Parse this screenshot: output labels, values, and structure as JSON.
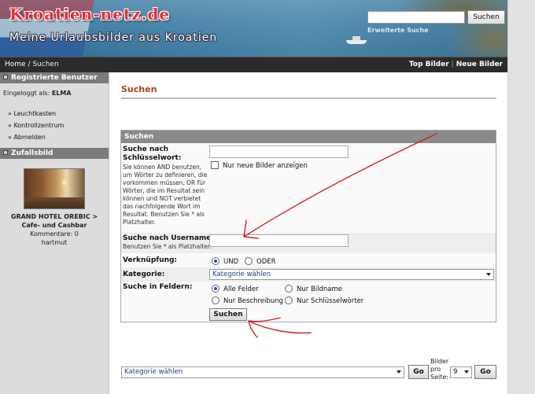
{
  "header": {
    "site_title": "Kroatien-netz.de",
    "subtitle": "Meine Urlaubsbilder aus Kroatien",
    "search_value": "",
    "search_button": "Suchen",
    "advanced_search": "Erweiterte Suche"
  },
  "navbar": {
    "home": "Home",
    "separator": " / ",
    "current": "Suchen",
    "top_images": "Top Bilder",
    "divider": "|",
    "new_images": "Neue Bilder"
  },
  "sidebar": {
    "registered_title": "Registrierte Benutzer",
    "logged_in_as": "Eingeloggt als: ",
    "username": "ELMA",
    "links": [
      "» Leuchtkasten",
      "» Kontrollzentrum",
      "» Abmelden"
    ],
    "random_title": "Zufallsbild",
    "random_caption_title": "GRAND HOTEL OREBIC > Cafe- und Cashbar",
    "random_comments": "Kommentare: 0",
    "random_author": "hartmut"
  },
  "main": {
    "page_title": "Suchen",
    "box_title": "Suchen",
    "keyword_label": "Suche nach Schlüsselwort:",
    "keyword_hint": "Sie können AND benutzen, um Wörter zu definieren, die vorkommen müssen, OR für Wörter, die im Resultat sein können und NOT verbietet das nachfolgende Wort im Resultat. Benutzen Sie * als Platzhalter.",
    "keyword_value": "",
    "new_only_label": "Nur neue Bilder anzeigen",
    "username_label": "Suche nach Username:",
    "username_hint": "Benutzen Sie * als Platzhalter.",
    "username_value": "",
    "link_label": "Verknüpfung:",
    "link_and": "UND",
    "link_or": "ODER",
    "category_label": "Kategorie:",
    "category_value": "Kategorie wählen",
    "fields_label": "Suche in Feldern:",
    "field_all": "Alle Felder",
    "field_name": "Nur Bildname",
    "field_desc": "Nur Beschreibung",
    "field_keywords": "Nur Schlüsselwörter",
    "submit": "Suchen"
  },
  "bottom": {
    "category_value": "Kategorie wählen",
    "go": "Go",
    "per_page_label": "Bilder pro Seite:",
    "per_page_value": "9",
    "go2": "Go"
  },
  "colors": {
    "accent": "#b23b1f",
    "annotation": "#d81c1c"
  }
}
